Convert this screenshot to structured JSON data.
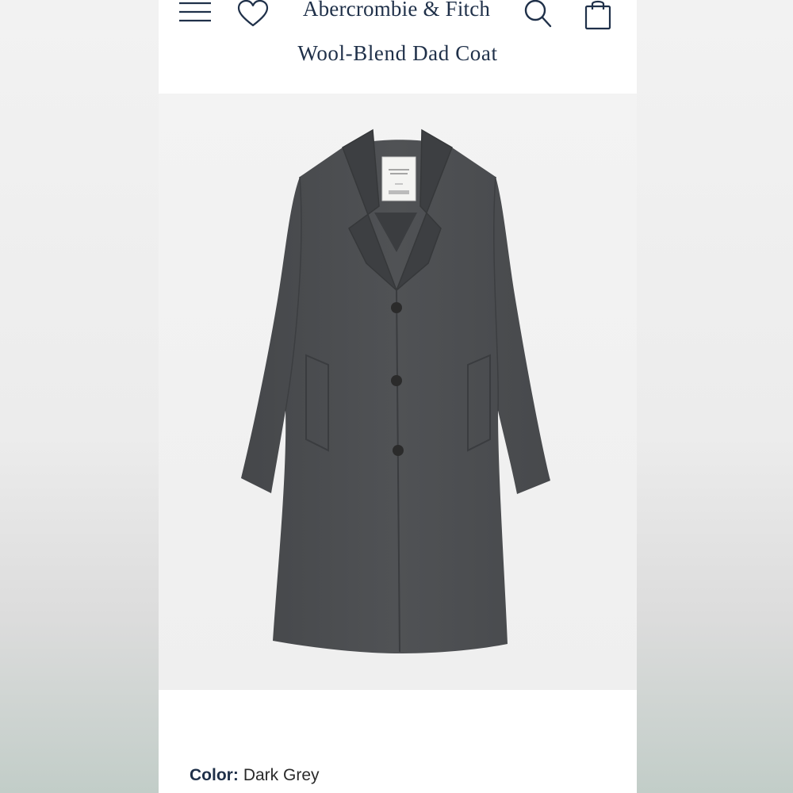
{
  "header": {
    "brand": "Abercrombie & Fitch",
    "icons": [
      "menu-icon",
      "heart-icon",
      "search-icon",
      "bag-icon"
    ]
  },
  "product": {
    "title": "Wool-Blend Dad Coat",
    "image_alt": "Dark grey wool-blend coat",
    "color_label": "Color:",
    "color_value": "Dark Grey"
  },
  "colors": {
    "brand_navy": "#1f3049",
    "coat_grey": "#4a4c4e"
  }
}
